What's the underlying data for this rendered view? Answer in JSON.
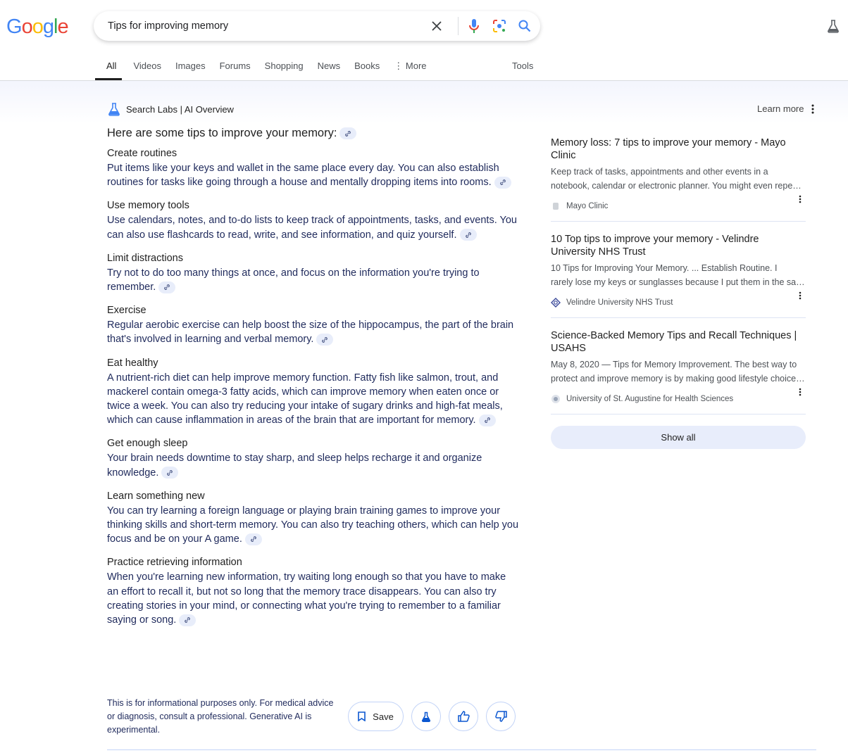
{
  "logo": {
    "text": "Google",
    "letters": [
      {
        "c": "G",
        "color": "#4285f4"
      },
      {
        "c": "o",
        "color": "#ea4335"
      },
      {
        "c": "o",
        "color": "#fbbc05"
      },
      {
        "c": "g",
        "color": "#4285f4"
      },
      {
        "c": "l",
        "color": "#34a853"
      },
      {
        "c": "e",
        "color": "#ea4335"
      }
    ]
  },
  "search": {
    "query": "Tips for improving memory"
  },
  "tabs": [
    "All",
    "Videos",
    "Images",
    "Forums",
    "Shopping",
    "News",
    "Books",
    "More"
  ],
  "tools": "Tools",
  "ai": {
    "header": "Search Labs | AI Overview",
    "learn_more": "Learn more",
    "intro": "Here are some tips to improve your memory:",
    "sections": [
      {
        "title": "Create routines",
        "text": "Put items like your keys and wallet in the same place every day. You can also establish routines for tasks like going through a house and mentally dropping items into rooms."
      },
      {
        "title": "Use memory tools",
        "text": "Use calendars, notes, and to-do lists to keep track of appointments, tasks, and events. You can also use flashcards to read, write, and see information, and quiz yourself."
      },
      {
        "title": "Limit distractions",
        "text": "Try not to do too many things at once, and focus on the information you're trying to remember."
      },
      {
        "title": "Exercise",
        "text": "Regular aerobic exercise can help boost the size of the hippocampus, the part of the brain that's involved in learning and verbal memory."
      },
      {
        "title": "Eat healthy",
        "text": "A nutrient-rich diet can help improve memory function. Fatty fish like salmon, trout, and mackerel contain omega-3 fatty acids, which can improve memory when eaten once or twice a week. You can also try reducing your intake of sugary drinks and high-fat meals, which can cause inflammation in areas of the brain that are important for memory."
      },
      {
        "title": "Get enough sleep",
        "text": "Your brain needs downtime to stay sharp, and sleep helps recharge it and organize knowledge."
      },
      {
        "title": "Learn something new",
        "text": "You can try learning a foreign language or playing brain training games to improve your thinking skills and short-term memory. You can also try teaching others, which can help you focus and be on your A game."
      },
      {
        "title": "Practice retrieving information",
        "text": "When you're learning new information, try waiting long enough so that you have to make an effort to recall it, but not so long that the memory trace disappears. You can also try creating stories in your mind, or connecting what you're trying to remember to a familiar saying or song."
      }
    ],
    "disclaimer": "This is for informational purposes only. For medical advice or diagnosis, consult a professional. Generative AI is experimental.",
    "save": "Save"
  },
  "sources": [
    {
      "title": "Memory loss: 7 tips to improve your memory - Mayo Clinic",
      "snippet1": "Keep track of tasks, appointments and other events in a",
      "snippet2": "notebook, calendar or electronic planner. You might even repeat...",
      "site": "Mayo Clinic"
    },
    {
      "title": "10 Top tips to improve your memory - Velindre University NHS Trust",
      "snippet1": "10 Tips for Improving Your Memory. ... Establish Routine. I",
      "snippet2": "rarely lose my keys or sunglasses because I put them in the same...",
      "site": "Velindre University NHS Trust"
    },
    {
      "title": "Science-Backed Memory Tips and Recall Techniques | USAHS",
      "snippet1": "May 8, 2020 — Tips for Memory Improvement. The best way to",
      "snippet2": "protect and improve memory is by making good lifestyle choices...",
      "site": "University of St. Augustine for Health Sciences"
    }
  ],
  "show_all": "Show all",
  "colors": {
    "accent": "#0b57d0",
    "body_text": "#1f2a5c",
    "chip": "#e8edfa"
  }
}
